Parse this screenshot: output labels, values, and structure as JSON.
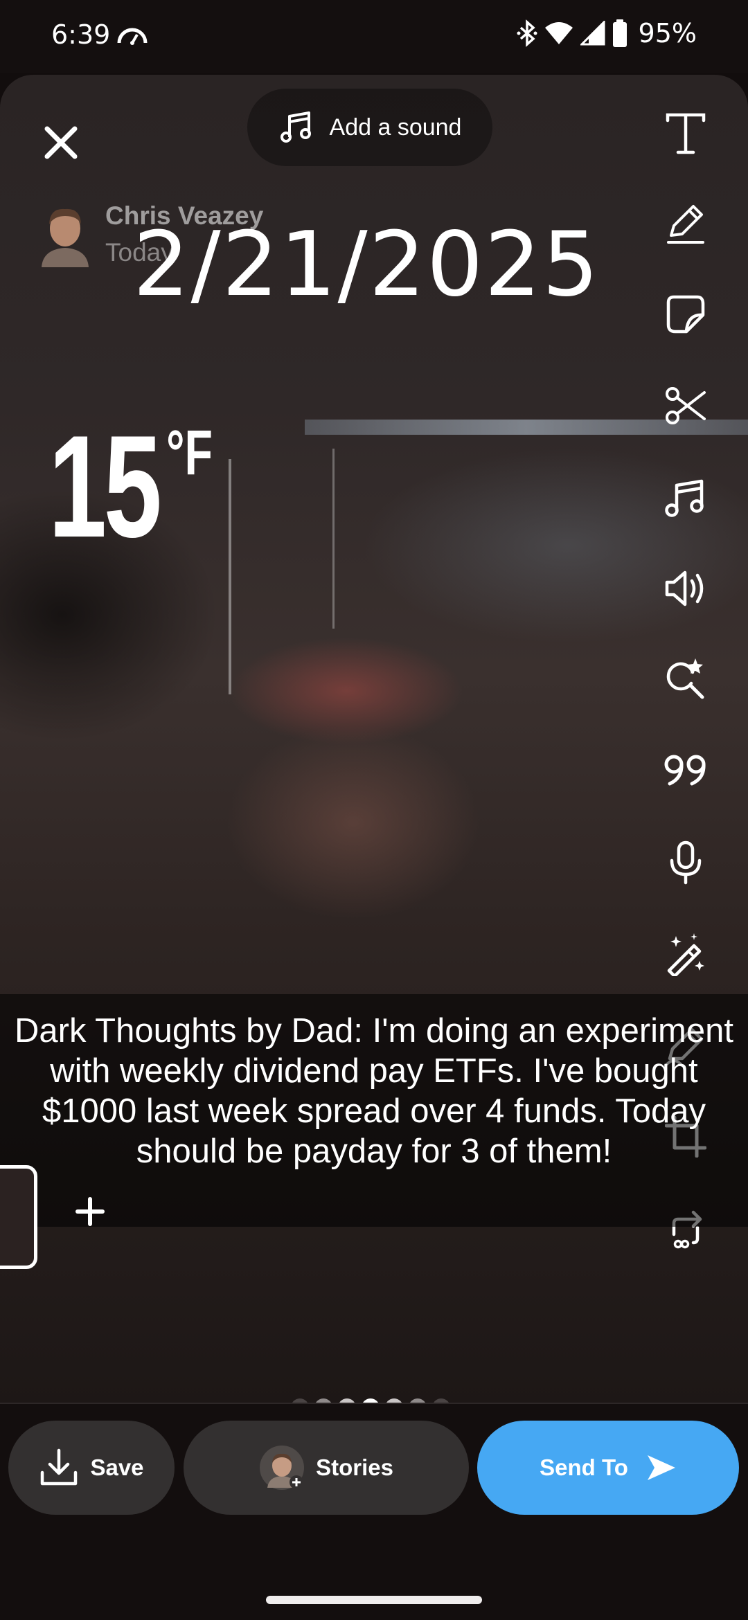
{
  "status_bar": {
    "time": "6:39",
    "battery": "95%",
    "icons": [
      "speedometer-icon",
      "bluetooth-icon",
      "wifi-icon",
      "signal-icon",
      "battery-icon"
    ]
  },
  "editor": {
    "add_sound_label": "Add a sound",
    "user": {
      "name": "Chris Veazey",
      "time": "Today"
    },
    "date_sticker": "2/21/2025",
    "temperature": {
      "value": "15",
      "unit": "°F"
    },
    "caption": "Dark Thoughts by Dad: I'm doing an experiment with weekly dividend pay ETFs. I've bought $1000 last week spread over 4 funds.  Today should be payday for 3 of them!",
    "tools": [
      "text-icon",
      "pencil-icon",
      "sticker-icon",
      "scissors-icon",
      "music-icon",
      "volume-icon",
      "lens-search-icon",
      "quote-icon",
      "microphone-icon",
      "magic-wand-icon",
      "pencil-eraser-icon",
      "crop-icon",
      "loop-icon"
    ],
    "page_dots": {
      "count": 7,
      "active_index": 3
    }
  },
  "actions": {
    "save_label": "Save",
    "stories_label": "Stories",
    "send_label": "Send To"
  },
  "colors": {
    "send_button": "#46a8f3",
    "pill_button": "#333030",
    "background": "#120d0d"
  }
}
